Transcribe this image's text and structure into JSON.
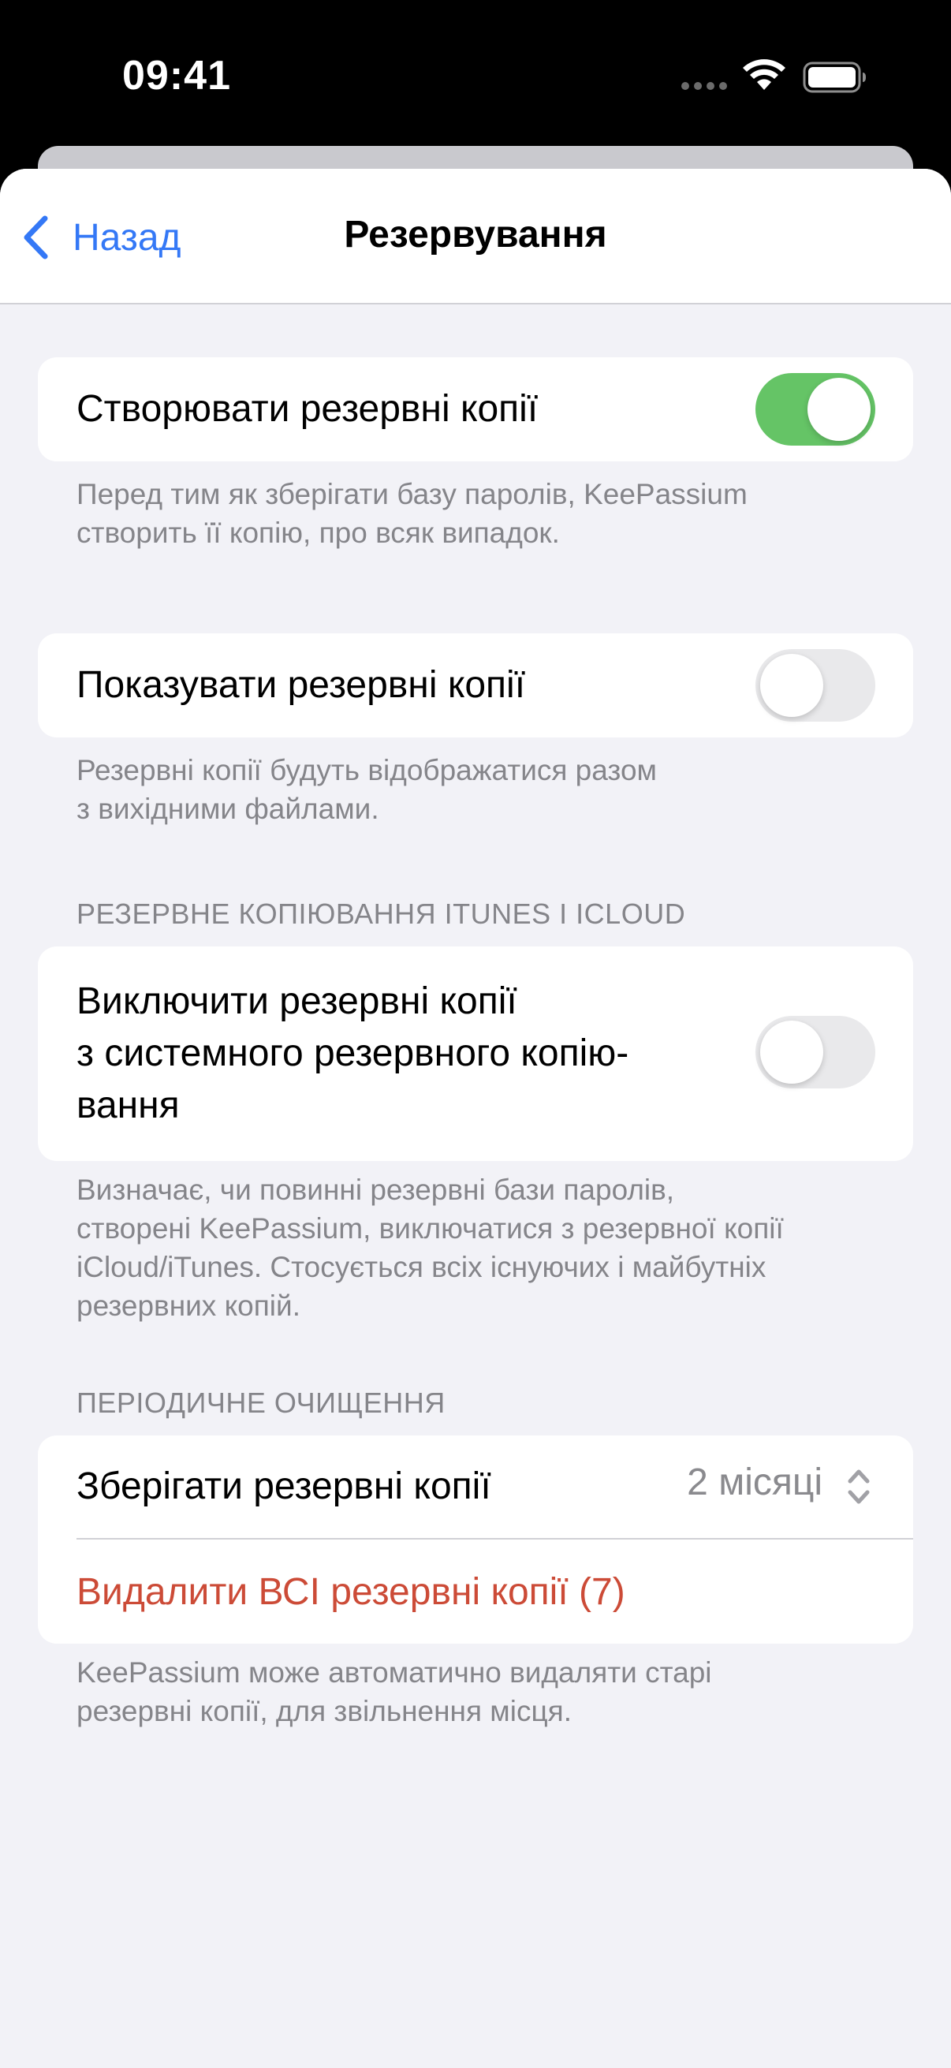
{
  "status_bar": {
    "time": "09:41",
    "icons": [
      "signal-dots-icon",
      "wifi-icon",
      "battery-icon"
    ]
  },
  "nav": {
    "back_label": "Назад",
    "title": "Резервування"
  },
  "sections": {
    "create_backups": {
      "label": "Створювати резервні копії",
      "toggle_on": true,
      "footer_line1": "Перед тим як зберігати базу паролів, KeePassium",
      "footer_line2": "створить її копію, про всяк випадок."
    },
    "show_backups": {
      "label": "Показувати резервні копії",
      "toggle_on": false,
      "footer_line1": "Резервні копії будуть відображатися разом",
      "footer_line2": "з вихідними файлами."
    },
    "itunes_icloud": {
      "header": "РЕЗЕРВНЕ КОПІЮВАННЯ ITUNES І ICLOUD",
      "label_line1": "Виключити резервні копії",
      "label_line2": "з системного резервного копію-",
      "label_line3": "вання",
      "toggle_on": false,
      "footer_line1": "Визначає, чи повинні резервні бази паролів,",
      "footer_line2": "створені KeePassium, виключатися з резервної копії",
      "footer_line3": "iCloud/iTunes. Стосується всіх існуючих і майбутніх",
      "footer_line4": "резервних копій."
    },
    "cleanup": {
      "header": "ПЕРІОДИЧНЕ ОЧИЩЕННЯ",
      "keep_label": "Зберігати резервні копії",
      "keep_value": "2 місяці",
      "delete_label": "Видалити ВСІ резервні копії (7)",
      "footer_line1": "KeePassium може автоматично видаляти старі",
      "footer_line2": "резервні копії, для звільнення місця."
    }
  },
  "colors": {
    "accent": "#3478f6",
    "toggle_on": "#65c466",
    "destructive": "#cc4b37",
    "background": "#f2f2f7",
    "secondary_text": "#85858a"
  }
}
